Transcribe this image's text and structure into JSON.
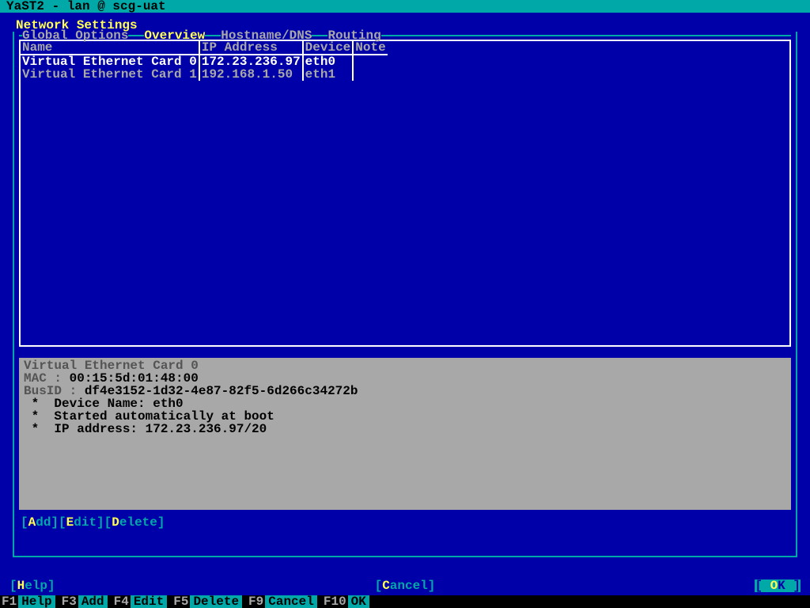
{
  "window": {
    "title": "YaST2 - lan @ scg-uat"
  },
  "page_title": "Network Settings",
  "tabs": {
    "items": [
      "Global Options",
      "Overview",
      "Hostname/DNS",
      "Routing"
    ],
    "selected_index": 1
  },
  "device_table": {
    "columns": [
      "Name",
      "IP Address",
      "Device",
      "Note"
    ],
    "rows": [
      {
        "name": "Virtual Ethernet Card 0",
        "ip": "172.23.236.97",
        "device": "eth0",
        "note": "",
        "selected": true
      },
      {
        "name": "Virtual Ethernet Card 1",
        "ip": "192.168.1.50",
        "device": "eth1",
        "note": "",
        "selected": false
      }
    ]
  },
  "detail": {
    "title": "Virtual Ethernet Card 0",
    "mac_label": "MAC : ",
    "mac": "00:15:5d:01:48:00",
    "busid_label": "BusID : ",
    "busid": "df4e3152-1d32-4e87-82f5-6d266c34272b",
    "bullets": [
      "Device Name: eth0",
      "Started automatically at boot",
      "IP address: 172.23.236.97/20"
    ]
  },
  "actions": {
    "add": "Add",
    "edit": "Edit",
    "delete": "Delete"
  },
  "footer": {
    "help": "Help",
    "cancel": "Cancel",
    "ok": "OK"
  },
  "fkeys": [
    {
      "key": "F1",
      "label": "Help"
    },
    {
      "key": "F3",
      "label": "Add"
    },
    {
      "key": "F4",
      "label": "Edit"
    },
    {
      "key": "F5",
      "label": "Delete"
    },
    {
      "key": "F9",
      "label": "Cancel"
    },
    {
      "key": "F10",
      "label": "OK"
    }
  ]
}
